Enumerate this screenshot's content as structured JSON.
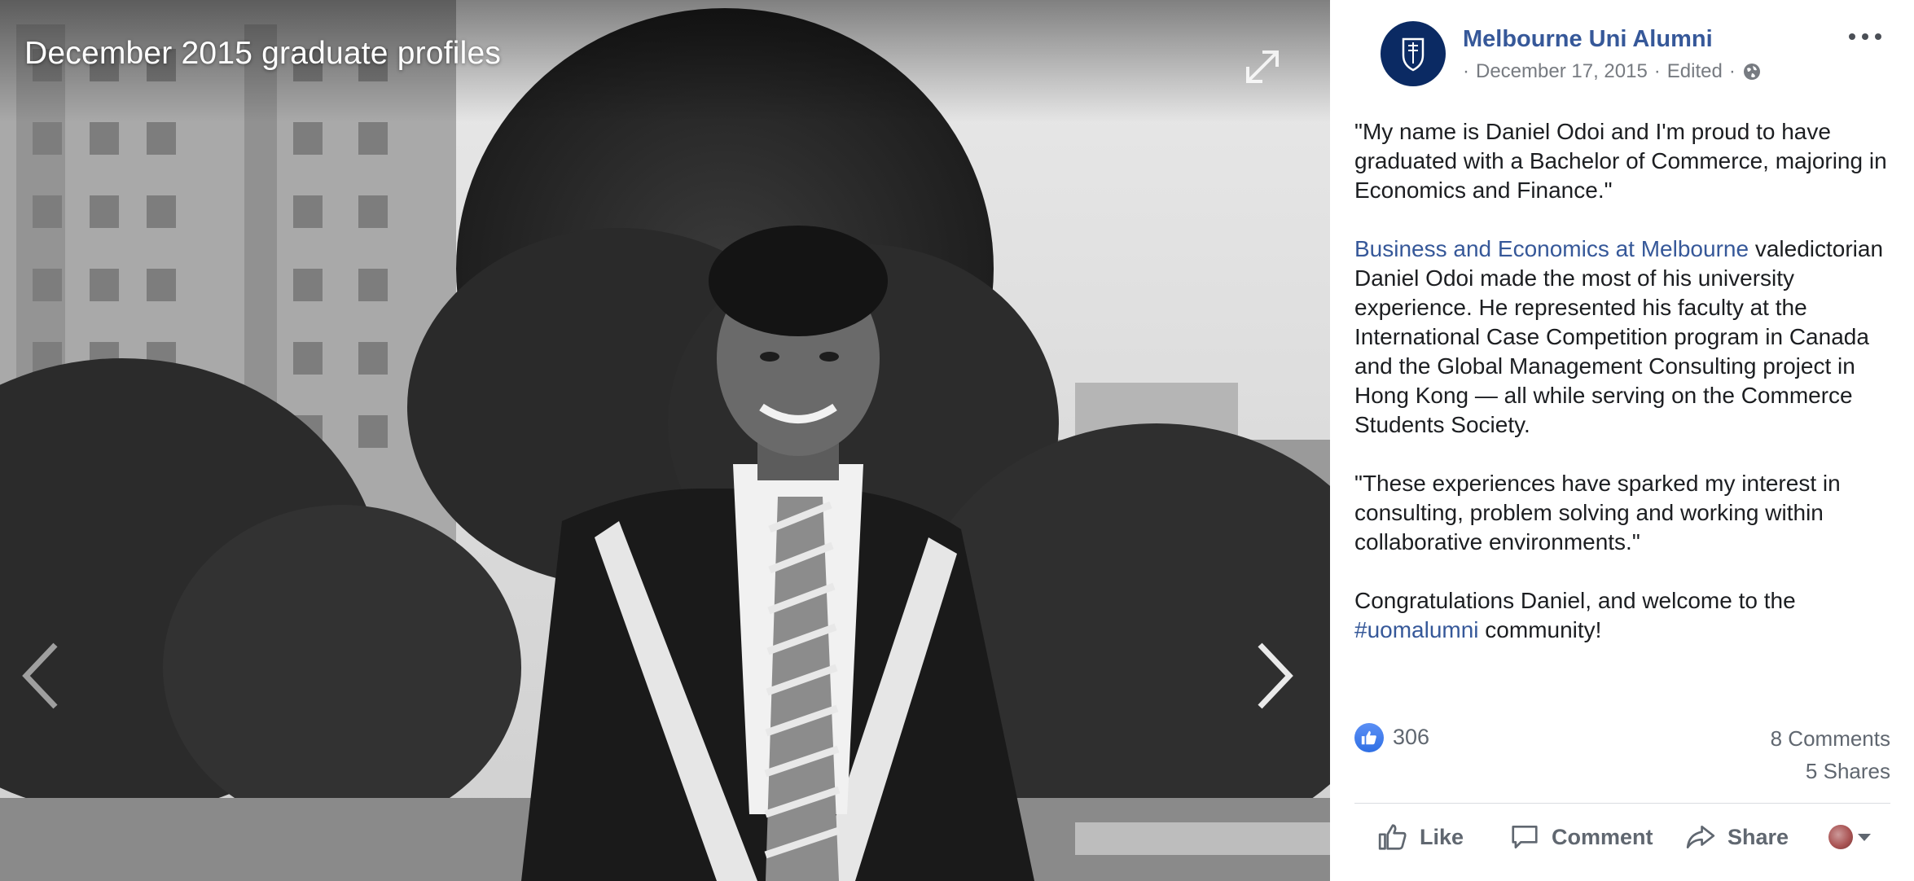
{
  "photo": {
    "album_title": "December 2015 graduate profiles",
    "icons": {
      "expand": "expand-icon",
      "prev": "chevron-left-icon",
      "next": "chevron-right-icon"
    }
  },
  "post": {
    "page_name": "Melbourne Uni Alumni",
    "meta_prefix": "·",
    "date": "December 17, 2015",
    "separator": "·",
    "edited": "Edited",
    "separator2": "·",
    "audience_icon": "globe-icon",
    "paragraph1": "\"My name is Daniel Odoi and I'm proud to have graduated with a Bachelor of Commerce, majoring in Economics and Finance.\"",
    "paragraph2_link": "Business and Economics at Melbourne",
    "paragraph2_text": " valedictorian Daniel Odoi made the most of his university experience. He represented his faculty at the International Case Competition program in Canada and the Global Management Consulting project in Hong Kong — all while serving on the Commerce Students Society.",
    "paragraph3": "\"These experiences have sparked my interest in consulting, problem solving and working within collaborative environments.\"",
    "paragraph4_text": "Congratulations Daniel, and welcome to the",
    "paragraph4_hashtag": "#uomalumni",
    "paragraph4_end": " community!"
  },
  "stats": {
    "likes": "306",
    "comments": "8 Comments",
    "shares": "5 Shares"
  },
  "actions": {
    "like": "Like",
    "comment": "Comment",
    "share": "Share"
  },
  "colors": {
    "link": "#365899",
    "muted": "#606770",
    "like_blue": "#2f6fe4",
    "avatar_bg": "#0b2a63"
  }
}
